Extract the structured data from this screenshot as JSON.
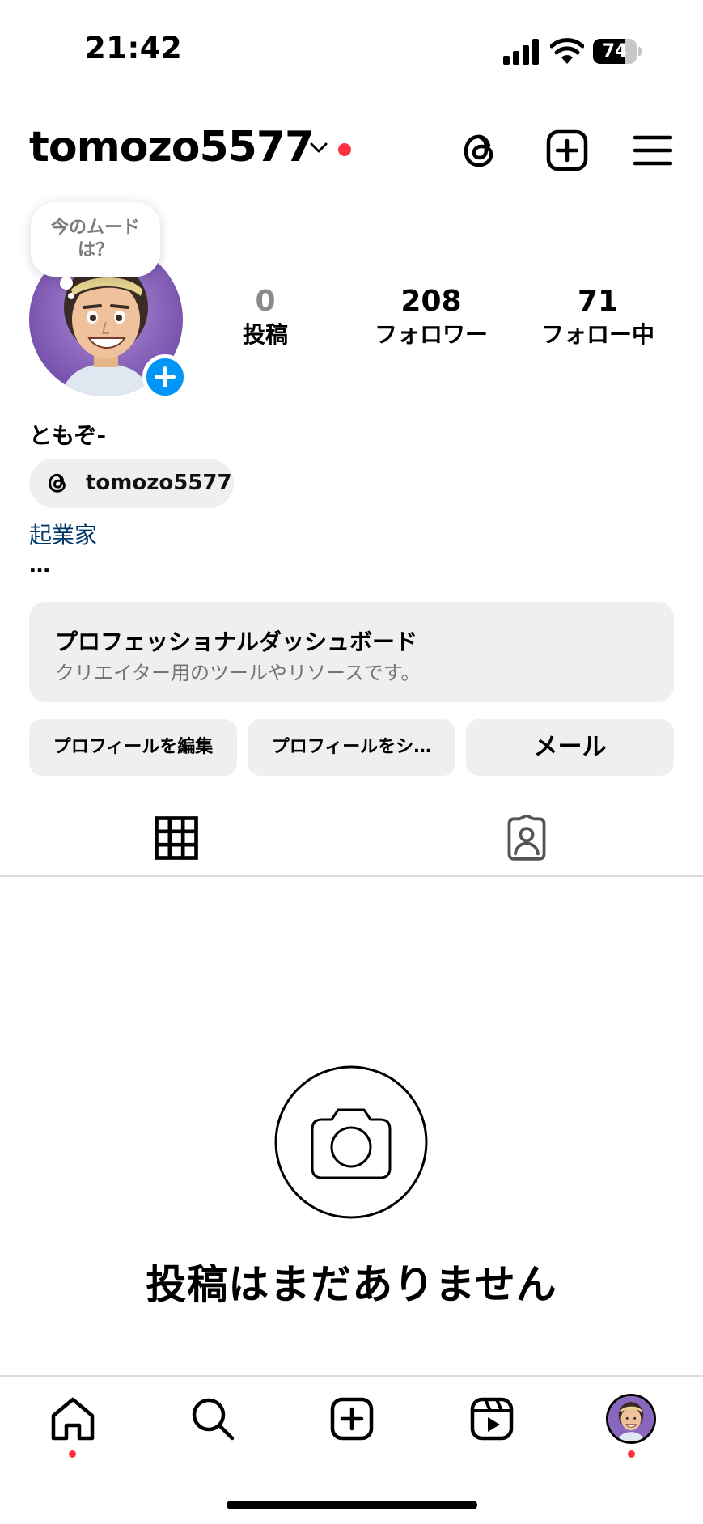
{
  "status_bar": {
    "time": "21:42",
    "battery": "74",
    "battery_level": 0.74,
    "icons": [
      "cellular-signal-icon",
      "wifi-icon",
      "battery-icon"
    ]
  },
  "header": {
    "username": "tomozo5577",
    "account_switcher_icon": "chevron-down-icon",
    "has_notification_dot": true,
    "actions": [
      "threads-icon",
      "add-icon",
      "menu-icon"
    ]
  },
  "profile": {
    "note_prompt": "今のムード\nは？",
    "stats": {
      "posts": {
        "value": "0",
        "label": "投稿"
      },
      "followers": {
        "value": "208",
        "label": "フォロワー"
      },
      "following": {
        "value": "71",
        "label": "フォロー中"
      }
    },
    "display_name": "ともぞ-",
    "threads_handle": "tomozo5577",
    "category": "起業家",
    "bio_more": "…"
  },
  "dashboard": {
    "title": "プロフェッショナルダッシュボード",
    "subtitle": "クリエイター用のツールやリソースです。"
  },
  "actions": {
    "edit_profile": "プロフィールを編集",
    "share_profile": "プロフィールをシ…",
    "email": "メール"
  },
  "tabs": [
    "grid-icon",
    "tagged-icon"
  ],
  "empty_state": {
    "title": "投稿はまだありません",
    "icon": "camera-icon"
  },
  "bottom_nav": [
    "home-icon",
    "search-icon",
    "create-icon",
    "reels-icon",
    "profile-avatar"
  ],
  "colors": {
    "accent_blue": "#0095f6",
    "link_blue": "#00376b",
    "notification_red": "#ff3040",
    "button_gray": "#efefef"
  }
}
